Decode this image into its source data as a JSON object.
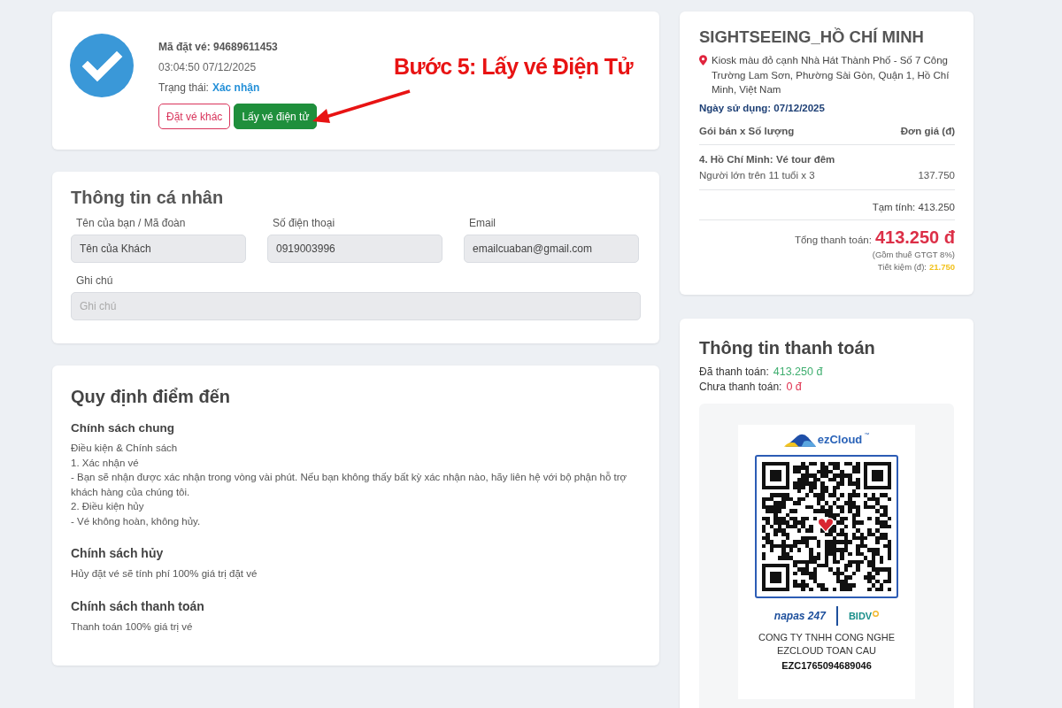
{
  "booking": {
    "code": "Mã đặt vé: 94689611453",
    "time": "03:04:50 07/12/2025",
    "status_label": "Trạng thái:",
    "status": "Xác nhận",
    "buttons": [
      {
        "label": "Đặt vé khác",
        "kind": "outline"
      },
      {
        "label": "Lấy vé điện tử",
        "kind": "primary"
      }
    ]
  },
  "annotation": {
    "text": "Bước 5: Lấy vé Điện Tử"
  },
  "personal": {
    "title": "Thông tin cá nhân",
    "fields": [
      {
        "label": "Tên của bạn / Mã đoàn",
        "value": "Tên của Khách"
      },
      {
        "label": "Số điện thoại",
        "value": "0919003996"
      },
      {
        "label": "Email",
        "value": "emailcuaban@gmail.com"
      }
    ],
    "note": {
      "label": "Ghi chú",
      "placeholder": "Ghi chú"
    }
  },
  "rules": {
    "title": "Quy định điểm đến",
    "sections": [
      {
        "heading": "Chính sách chung",
        "lines": [
          "Điều kiện & Chính sách",
          "1. Xác nhận vé",
          "- Bạn sẽ nhận được xác nhận trong vòng vài phút. Nếu bạn không thấy bất kỳ xác nhận nào, hãy liên hệ với bộ phận hỗ trợ khách hàng của chúng tôi.",
          "2. Điều kiện hủy",
          "- Vé không hoàn, không hủy."
        ]
      },
      {
        "heading": "Chính sách hủy",
        "lines": [
          "Hủy đặt vé sẽ tính phí 100% giá trị đặt vé"
        ]
      },
      {
        "heading": "Chính sách thanh toán",
        "lines": [
          "Thanh toán 100% giá trị vé"
        ]
      }
    ]
  },
  "order": {
    "title": "SIGHTSEEING_HỒ CHÍ MINH",
    "address": "Kiosk màu đỏ cạnh Nhà Hát Thành Phố - Số 7 Công Trường Lam Sơn, Phường Sài Gòn, Quận 1, Hồ Chí Minh, Việt Nam",
    "date": "Ngày sử dụng: 07/12/2025",
    "columns": [
      "Gói bán x Số lượng",
      "Đơn giá (đ)"
    ],
    "item": {
      "name": "4. Hồ Chí Minh: Vé tour đêm",
      "line": "Người lớn trên 11 tuổi x 3",
      "price": "137.750"
    },
    "subtotal": "Tạm tính: 413.250",
    "total_label": "Tổng thanh toán:",
    "total": "413.250 đ",
    "tax_note": "(Gồm thuế GTGT 8%)",
    "savings_label": "Tiết kiệm (đ):",
    "savings": "21.750"
  },
  "payment": {
    "title": "Thông tin thanh toán",
    "rows": [
      {
        "label": "Đã thanh toán:",
        "value": "413.250 đ",
        "color": "#3fae6f"
      },
      {
        "label": "Chưa thanh toán:",
        "value": "0 đ",
        "color": "#e0314f"
      }
    ],
    "qr": {
      "brand": "ezCloud",
      "brand_mark": "™",
      "network": "napas 247",
      "bank": "BIDV",
      "company": "CONG TY TNHH CONG NGHE EZCLOUD TOAN CAU",
      "reference": "EZC1765094689046"
    }
  }
}
